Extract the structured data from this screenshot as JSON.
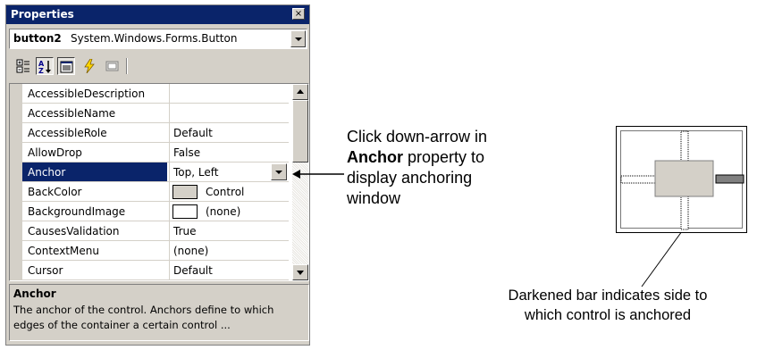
{
  "window": {
    "title": "Properties",
    "close_glyph": "×"
  },
  "object_selector": {
    "name": "button2",
    "type": "System.Windows.Forms.Button"
  },
  "toolbar": {
    "buttons": [
      "categorized-icon",
      "alphabetical-icon",
      "properties-icon",
      "events-icon",
      "property-pages-icon"
    ]
  },
  "properties": [
    {
      "name": "AccessibleDescription",
      "value": ""
    },
    {
      "name": "AccessibleName",
      "value": ""
    },
    {
      "name": "AccessibleRole",
      "value": "Default"
    },
    {
      "name": "AllowDrop",
      "value": "False"
    },
    {
      "name": "Anchor",
      "value": "Top, Left"
    },
    {
      "name": "BackColor",
      "value": "Control",
      "swatch": "#d4d0c8"
    },
    {
      "name": "BackgroundImage",
      "value": "(none)",
      "swatch": "#ffffff"
    },
    {
      "name": "CausesValidation",
      "value": "True"
    },
    {
      "name": "ContextMenu",
      "value": "(none)"
    },
    {
      "name": "Cursor",
      "value": "Default"
    }
  ],
  "description": {
    "title": "Anchor",
    "text": "The anchor of the control. Anchors define to which edges of the container a certain control ..."
  },
  "annotations": {
    "callout1_a": "Click down-arrow in",
    "callout1_bold": "Anchor",
    "callout1_b": " property to",
    "callout1_c": "display anchoring",
    "callout1_d": "window",
    "callout2_a": "Darkened bar indicates side to",
    "callout2_b": "which control is anchored"
  },
  "colors": {
    "selection": "#0a246a",
    "window_face": "#d4d0c8",
    "anchored_bar": "#808080"
  }
}
